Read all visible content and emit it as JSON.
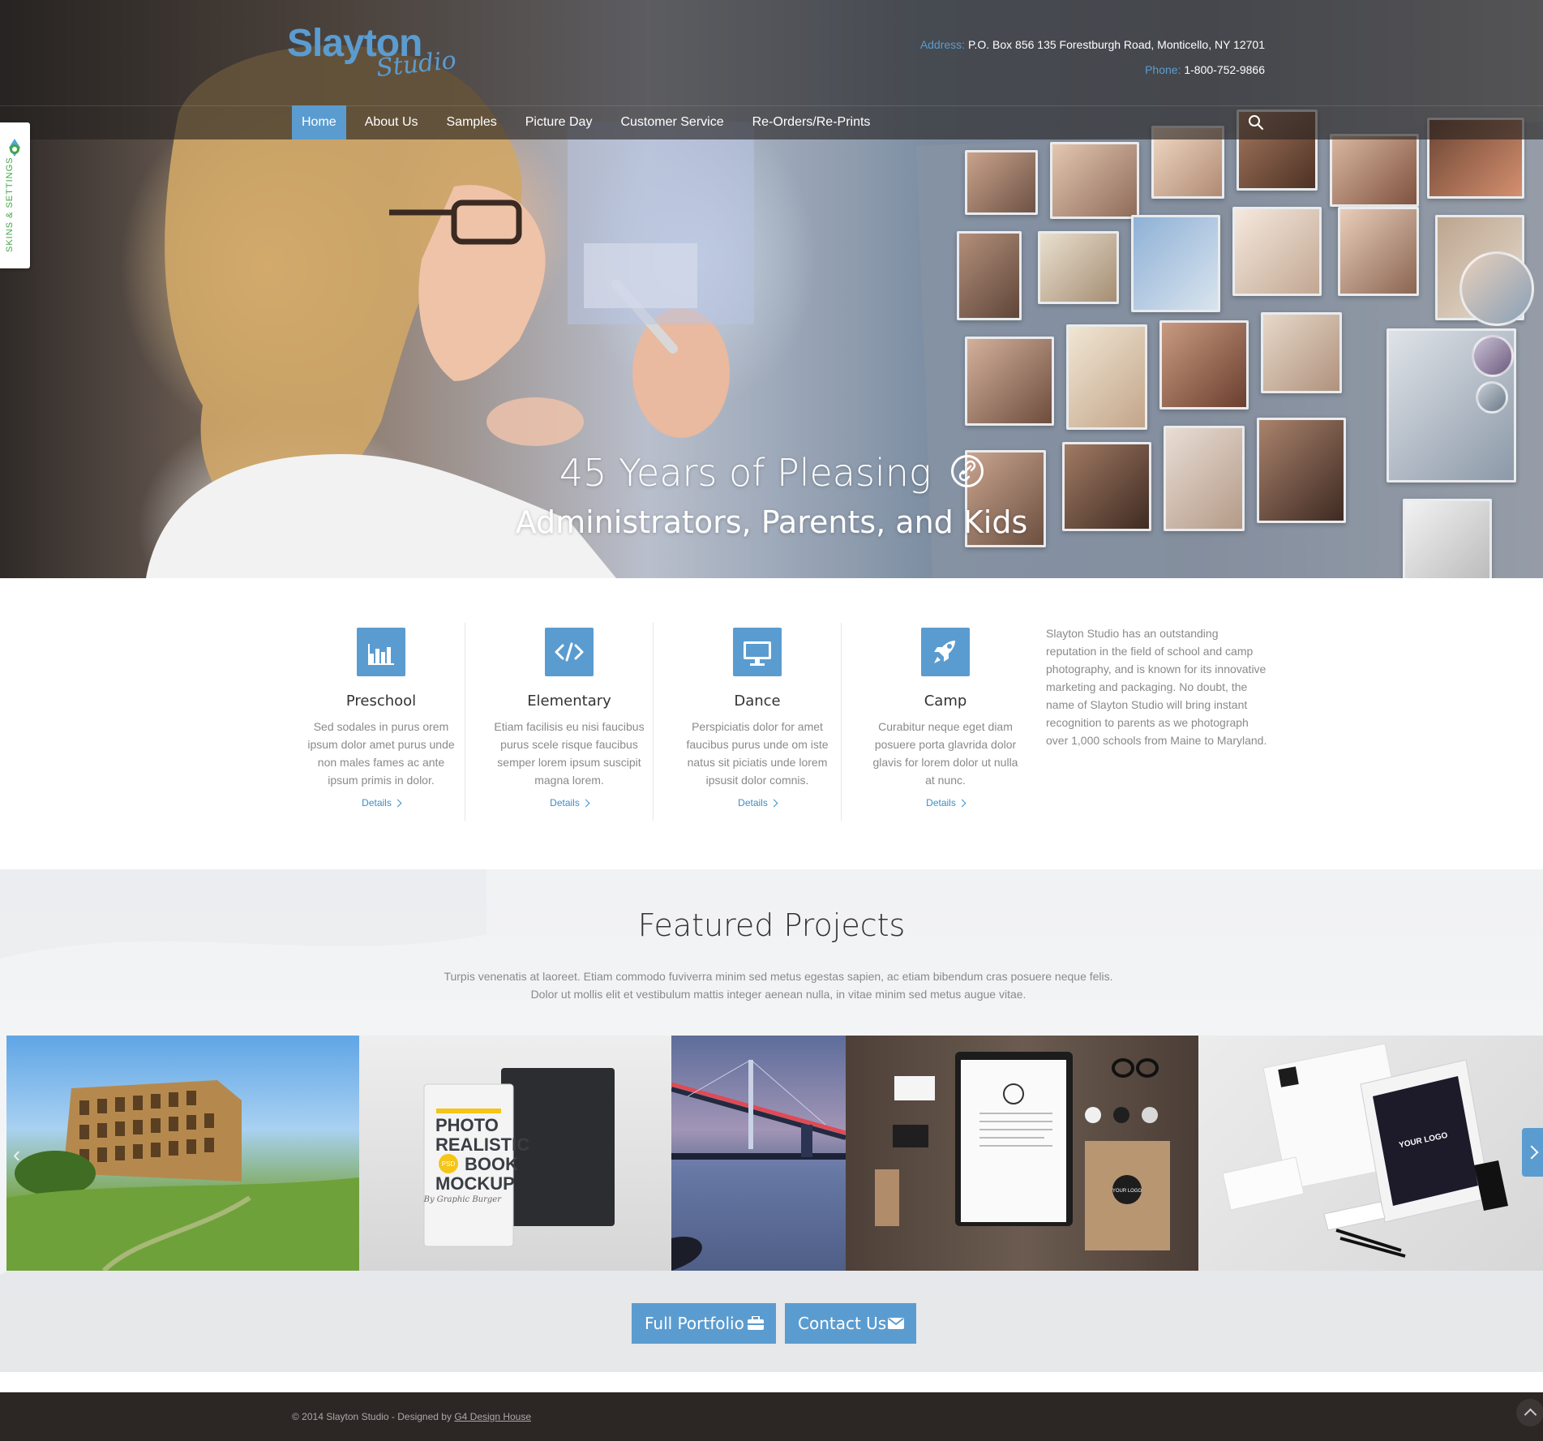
{
  "brand": {
    "name": "Slayton",
    "subname": "Studio"
  },
  "contact": {
    "address_label": "Address:",
    "address": "P.O. Box 856 135 Forestburgh Road, Monticello, NY 12701",
    "phone_label": "Phone:",
    "phone": "1-800-752-9866"
  },
  "nav": {
    "items": [
      {
        "label": "Home",
        "active": true
      },
      {
        "label": "About Us"
      },
      {
        "label": "Samples"
      },
      {
        "label": "Picture Day"
      },
      {
        "label": "Customer Service"
      },
      {
        "label": "Re-Orders/Re-Prints"
      }
    ],
    "search_icon": "search-icon"
  },
  "settings_tab": {
    "label": "SKINS & SETTINGS",
    "icon": "gear-icon"
  },
  "hero": {
    "title": "45 Years of Pleasing",
    "subtitle": "Administrators, Parents, and Kids",
    "icon": "link-icon"
  },
  "services": [
    {
      "title": "Preschool",
      "icon": "bar-chart-icon",
      "text": "Sed sodales in purus orem ipsum dolor amet  purus unde non males fames ac ante ipsum primis in dolor.",
      "link": "Details"
    },
    {
      "title": "Elementary",
      "icon": "code-icon",
      "text": "Etiam facilisis eu nisi faucibus purus scele risque faucibus semper lorem ipsum suscipit magna lorem.",
      "link": "Details"
    },
    {
      "title": "Dance",
      "icon": "monitor-icon",
      "text": "Perspiciatis dolor for amet faucibus purus unde om iste natus sit piciatis unde lorem ipsusit dolor comnis.",
      "link": "Details"
    },
    {
      "title": "Camp",
      "icon": "rocket-icon",
      "text": "Curabitur neque eget diam posuere porta glavrida dolor glavis for lorem dolor ut nulla at nunc.",
      "link": "Details"
    }
  ],
  "about_text": "Slayton Studio has an outstanding reputation in the field of school and camp photography, and is known for its innovative marketing and packaging. No doubt, the name of Slayton Studio will bring instant recognition to parents as we photograph over 1,000 schools from Maine to Maryland.",
  "featured": {
    "title": "Featured Projects",
    "text_line1": "Turpis venenatis at laoreet. Etiam commodo fuviverra minim sed metus egestas sapien, ac etiam bibendum cras posuere neque felis.",
    "text_line2": "Dolor ut mollis elit et vestibulum mattis integer aenean nulla, in vitae minim sed metus augue vitae.",
    "gallery": [
      {
        "name": "colosseum"
      },
      {
        "name": "book-mockup",
        "book_text": [
          "PHOTO",
          "REALISTIC",
          "BOOK",
          "MOCKUP"
        ],
        "byline": "By Graphic Burger",
        "badge": "PSD"
      },
      {
        "name": "bridge"
      },
      {
        "name": "stationery-desk",
        "logo_text": "YOUR LOGO"
      },
      {
        "name": "branding-mockup",
        "logo_text": "YOUR LOGO"
      }
    ]
  },
  "buttons": {
    "portfolio": {
      "label": "Full Portfolio",
      "icon": "briefcase-icon"
    },
    "contact": {
      "label": "Contact Us",
      "icon": "envelope-icon"
    }
  },
  "footer": {
    "copyright": "© 2014 Slayton Studio - Designed by",
    "designer": "G4 Design House"
  },
  "colors": {
    "accent": "#5b9cd0",
    "footer_bg": "#2c2624",
    "text_muted": "#8a8a8a",
    "settings_green": "#43a547"
  }
}
